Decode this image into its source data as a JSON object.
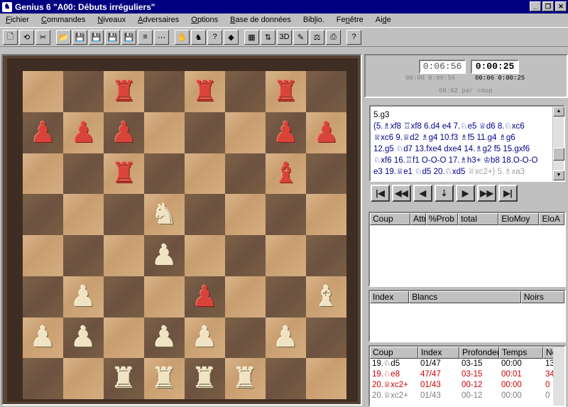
{
  "window": {
    "title": "Genius 6  \"A00: Débuts irréguliers\"",
    "app_icon": "knight-icon",
    "controls": [
      "_",
      "❐",
      "✕"
    ]
  },
  "menu": [
    {
      "pre": "",
      "u": "F",
      "post": "ichier"
    },
    {
      "pre": "",
      "u": "C",
      "post": "ommandes"
    },
    {
      "pre": "",
      "u": "N",
      "post": "iveaux"
    },
    {
      "pre": "",
      "u": "A",
      "post": "dversaires"
    },
    {
      "pre": "",
      "u": "O",
      "post": "ptions"
    },
    {
      "pre": "",
      "u": "B",
      "post": "ase de données"
    },
    {
      "pre": "Bib",
      "u": "l",
      "post": "io."
    },
    {
      "pre": "Fe",
      "u": "n",
      "post": "être"
    },
    {
      "pre": "Ai",
      "u": "d",
      "post": "e"
    }
  ],
  "toolbar": [
    {
      "name": "new-game-icon",
      "glyph": "🗋",
      "sep": false
    },
    {
      "name": "flip-board-icon",
      "glyph": "⟲",
      "sep": false
    },
    {
      "name": "cut-icon",
      "glyph": "✂",
      "sep": false
    },
    {
      "name": "open-folder-icon",
      "glyph": "📂",
      "sep": true
    },
    {
      "name": "save-icon",
      "glyph": "💾",
      "sep": false
    },
    {
      "name": "save-plus-icon",
      "glyph": "💾",
      "sep": false
    },
    {
      "name": "save-minus-icon",
      "glyph": "💾",
      "sep": false
    },
    {
      "name": "save-query-icon",
      "glyph": "💾",
      "sep": false
    },
    {
      "name": "text-format-icon",
      "glyph": "≡",
      "sep": false
    },
    {
      "name": "notation-format-icon",
      "glyph": "⋯",
      "sep": false
    },
    {
      "name": "hand-icon",
      "glyph": "✋",
      "sep": true
    },
    {
      "name": "players-icon",
      "glyph": "♞",
      "sep": false
    },
    {
      "name": "hint-question-icon",
      "glyph": "?",
      "sep": false
    },
    {
      "name": "lightbulb-icon",
      "glyph": "◆",
      "sep": false
    },
    {
      "name": "board-grid-icon",
      "glyph": "▦",
      "sep": true
    },
    {
      "name": "board-flip-icon",
      "glyph": "⇅",
      "sep": false
    },
    {
      "name": "board-3d-icon",
      "glyph": "3D",
      "sep": false
    },
    {
      "name": "pen-icon",
      "glyph": "✎",
      "sep": false
    },
    {
      "name": "scale-icon",
      "glyph": "⚖",
      "sep": false
    },
    {
      "name": "print-icon",
      "glyph": "⎙",
      "sep": false
    },
    {
      "name": "help-icon",
      "glyph": "?",
      "sep": true
    }
  ],
  "board": [
    [
      "",
      "",
      "wr",
      "",
      "wr",
      "",
      "wr",
      ""
    ],
    [
      "wp",
      "wp",
      "wp",
      "",
      "",
      "",
      "wp",
      "wp"
    ],
    [
      "",
      "",
      "wr",
      "",
      "",
      "",
      "wb",
      ""
    ],
    [
      "",
      "",
      "",
      "bn",
      "",
      "",
      "",
      ""
    ],
    [
      "",
      "",
      "",
      "bp",
      "",
      "",
      "",
      ""
    ],
    [
      "",
      "bp",
      "",
      "",
      "wp",
      "",
      "",
      "bb"
    ],
    [
      "bp",
      "bp",
      "",
      "bp",
      "bp",
      "",
      "bp",
      ""
    ],
    [
      "",
      "",
      "bk",
      "br",
      "bq",
      "br",
      "",
      ""
    ]
  ],
  "clock": {
    "main_left": "0:06:56",
    "main_right": "0:00:25",
    "sub_left": "00:00 0:06:56",
    "sub_right": "00:06 0:00:25",
    "per_move": "00:02 par coup"
  },
  "notation": {
    "first_line": "5.g3",
    "lines": [
      "(5.♗xf8 ♖xf8 6.d4 e4 7.♘e5 ♕d6 8.♘xc6",
      "♕xc6 9.♕d2 ♗g4 10.f3 ♗f5 11.g4 ♗g6",
      "12.g5 ♘d7 13.fxe4 dxe4 14.♗g2 f5 15.gxf6",
      "♘xf6 16.♖f1 O-O-O 17.♗h3+ ♔b8 18.O-O-O"
    ],
    "last_line_blue": "e3 19.♕e1 ♘d5 20.♘xd5 ",
    "last_line_grey": "♕xc2+) 5.♗xa3"
  },
  "nav_buttons": [
    {
      "name": "first-move-button",
      "glyph": "|◀"
    },
    {
      "name": "fast-back-button",
      "glyph": "◀◀"
    },
    {
      "name": "back-button",
      "glyph": "◀"
    },
    {
      "name": "variation-button",
      "glyph": "⇣"
    },
    {
      "name": "forward-button",
      "glyph": "▶"
    },
    {
      "name": "fast-forward-button",
      "glyph": "▶▶"
    },
    {
      "name": "last-move-button",
      "glyph": "▶|"
    }
  ],
  "opening_table": {
    "headers": [
      "Coup",
      "Attr",
      "%Prob",
      "total",
      "EloMoy",
      "EloA"
    ]
  },
  "game_table": {
    "headers": [
      "Index",
      "Blancs",
      "Noirs"
    ]
  },
  "analysis_table": {
    "headers": [
      "Coup",
      "Index",
      "Profondeur",
      "Temps",
      "Noeuds"
    ],
    "rows": [
      {
        "cells": [
          "19.♘d5",
          "01/47",
          "03-15",
          "00:00",
          "13"
        ],
        "style": "k"
      },
      {
        "cells": [
          "19.♘e8",
          "47/47",
          "03-15",
          "00:01",
          "34"
        ],
        "style": "r"
      },
      {
        "cells": [
          "20.♕xc2+",
          "01/43",
          "00-12",
          "00:00",
          "0"
        ],
        "style": "r"
      },
      {
        "cells": [
          "20.♕xc2+",
          "01/43",
          "00-12",
          "00:00",
          "0"
        ],
        "style": "g"
      }
    ]
  },
  "colors": {
    "title_bg": "#000080",
    "notation_text": "#00008b",
    "red_row": "#cc0000"
  }
}
